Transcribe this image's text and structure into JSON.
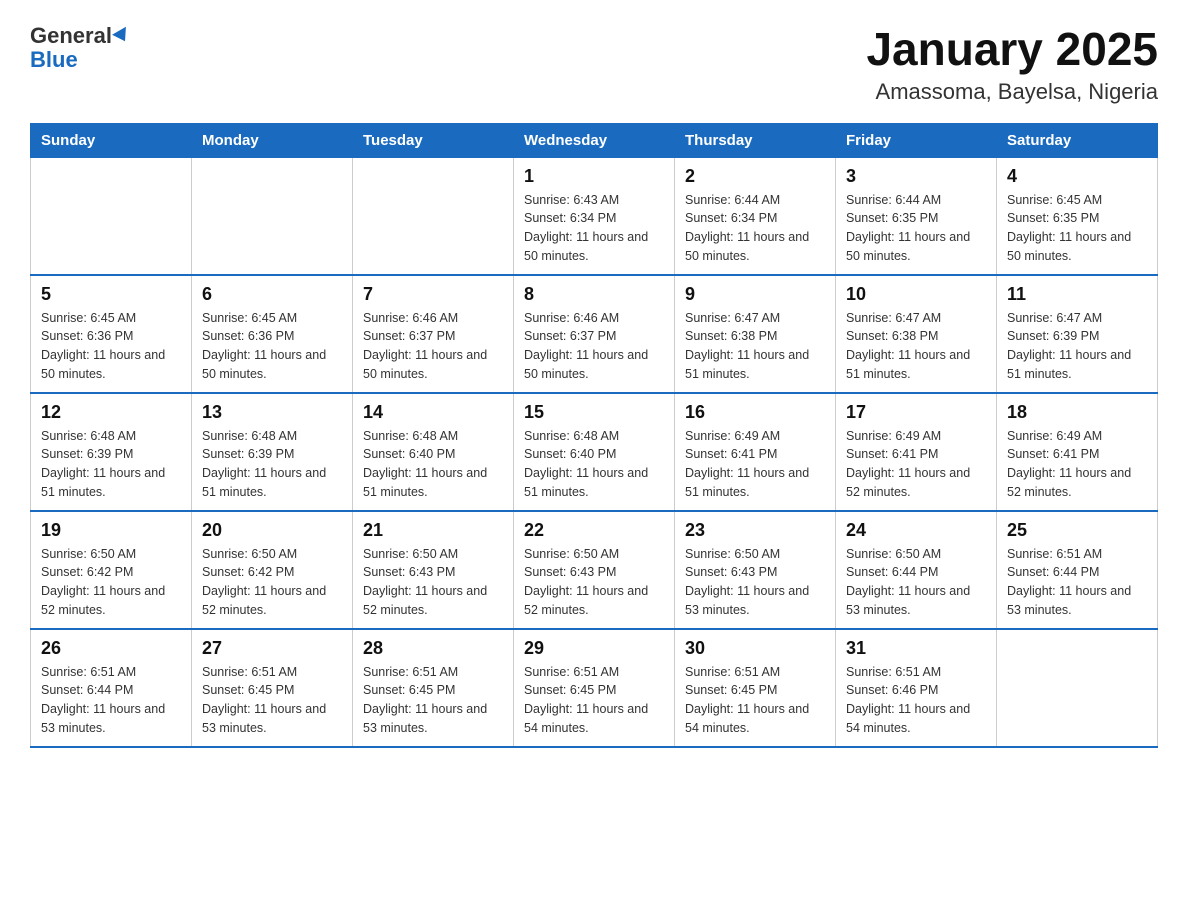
{
  "logo": {
    "general": "General",
    "blue": "Blue"
  },
  "title": "January 2025",
  "subtitle": "Amassoma, Bayelsa, Nigeria",
  "headers": [
    "Sunday",
    "Monday",
    "Tuesday",
    "Wednesday",
    "Thursday",
    "Friday",
    "Saturday"
  ],
  "weeks": [
    [
      {
        "day": "",
        "info": ""
      },
      {
        "day": "",
        "info": ""
      },
      {
        "day": "",
        "info": ""
      },
      {
        "day": "1",
        "info": "Sunrise: 6:43 AM\nSunset: 6:34 PM\nDaylight: 11 hours and 50 minutes."
      },
      {
        "day": "2",
        "info": "Sunrise: 6:44 AM\nSunset: 6:34 PM\nDaylight: 11 hours and 50 minutes."
      },
      {
        "day": "3",
        "info": "Sunrise: 6:44 AM\nSunset: 6:35 PM\nDaylight: 11 hours and 50 minutes."
      },
      {
        "day": "4",
        "info": "Sunrise: 6:45 AM\nSunset: 6:35 PM\nDaylight: 11 hours and 50 minutes."
      }
    ],
    [
      {
        "day": "5",
        "info": "Sunrise: 6:45 AM\nSunset: 6:36 PM\nDaylight: 11 hours and 50 minutes."
      },
      {
        "day": "6",
        "info": "Sunrise: 6:45 AM\nSunset: 6:36 PM\nDaylight: 11 hours and 50 minutes."
      },
      {
        "day": "7",
        "info": "Sunrise: 6:46 AM\nSunset: 6:37 PM\nDaylight: 11 hours and 50 minutes."
      },
      {
        "day": "8",
        "info": "Sunrise: 6:46 AM\nSunset: 6:37 PM\nDaylight: 11 hours and 50 minutes."
      },
      {
        "day": "9",
        "info": "Sunrise: 6:47 AM\nSunset: 6:38 PM\nDaylight: 11 hours and 51 minutes."
      },
      {
        "day": "10",
        "info": "Sunrise: 6:47 AM\nSunset: 6:38 PM\nDaylight: 11 hours and 51 minutes."
      },
      {
        "day": "11",
        "info": "Sunrise: 6:47 AM\nSunset: 6:39 PM\nDaylight: 11 hours and 51 minutes."
      }
    ],
    [
      {
        "day": "12",
        "info": "Sunrise: 6:48 AM\nSunset: 6:39 PM\nDaylight: 11 hours and 51 minutes."
      },
      {
        "day": "13",
        "info": "Sunrise: 6:48 AM\nSunset: 6:39 PM\nDaylight: 11 hours and 51 minutes."
      },
      {
        "day": "14",
        "info": "Sunrise: 6:48 AM\nSunset: 6:40 PM\nDaylight: 11 hours and 51 minutes."
      },
      {
        "day": "15",
        "info": "Sunrise: 6:48 AM\nSunset: 6:40 PM\nDaylight: 11 hours and 51 minutes."
      },
      {
        "day": "16",
        "info": "Sunrise: 6:49 AM\nSunset: 6:41 PM\nDaylight: 11 hours and 51 minutes."
      },
      {
        "day": "17",
        "info": "Sunrise: 6:49 AM\nSunset: 6:41 PM\nDaylight: 11 hours and 52 minutes."
      },
      {
        "day": "18",
        "info": "Sunrise: 6:49 AM\nSunset: 6:41 PM\nDaylight: 11 hours and 52 minutes."
      }
    ],
    [
      {
        "day": "19",
        "info": "Sunrise: 6:50 AM\nSunset: 6:42 PM\nDaylight: 11 hours and 52 minutes."
      },
      {
        "day": "20",
        "info": "Sunrise: 6:50 AM\nSunset: 6:42 PM\nDaylight: 11 hours and 52 minutes."
      },
      {
        "day": "21",
        "info": "Sunrise: 6:50 AM\nSunset: 6:43 PM\nDaylight: 11 hours and 52 minutes."
      },
      {
        "day": "22",
        "info": "Sunrise: 6:50 AM\nSunset: 6:43 PM\nDaylight: 11 hours and 52 minutes."
      },
      {
        "day": "23",
        "info": "Sunrise: 6:50 AM\nSunset: 6:43 PM\nDaylight: 11 hours and 53 minutes."
      },
      {
        "day": "24",
        "info": "Sunrise: 6:50 AM\nSunset: 6:44 PM\nDaylight: 11 hours and 53 minutes."
      },
      {
        "day": "25",
        "info": "Sunrise: 6:51 AM\nSunset: 6:44 PM\nDaylight: 11 hours and 53 minutes."
      }
    ],
    [
      {
        "day": "26",
        "info": "Sunrise: 6:51 AM\nSunset: 6:44 PM\nDaylight: 11 hours and 53 minutes."
      },
      {
        "day": "27",
        "info": "Sunrise: 6:51 AM\nSunset: 6:45 PM\nDaylight: 11 hours and 53 minutes."
      },
      {
        "day": "28",
        "info": "Sunrise: 6:51 AM\nSunset: 6:45 PM\nDaylight: 11 hours and 53 minutes."
      },
      {
        "day": "29",
        "info": "Sunrise: 6:51 AM\nSunset: 6:45 PM\nDaylight: 11 hours and 54 minutes."
      },
      {
        "day": "30",
        "info": "Sunrise: 6:51 AM\nSunset: 6:45 PM\nDaylight: 11 hours and 54 minutes."
      },
      {
        "day": "31",
        "info": "Sunrise: 6:51 AM\nSunset: 6:46 PM\nDaylight: 11 hours and 54 minutes."
      },
      {
        "day": "",
        "info": ""
      }
    ]
  ]
}
